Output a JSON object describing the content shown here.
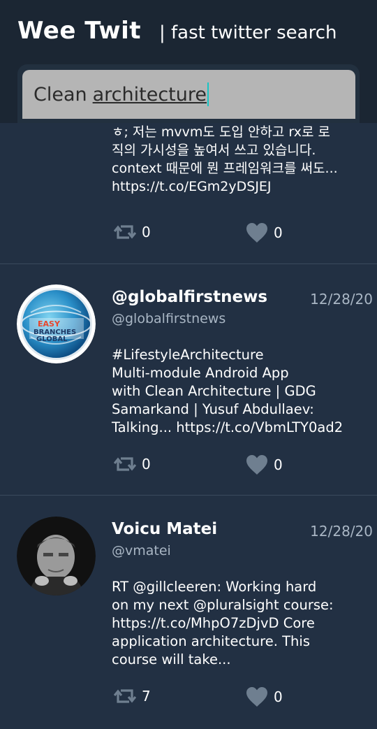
{
  "header": {
    "title": "Wee Twit",
    "subtitle": "| fast twitter search"
  },
  "search": {
    "value_prefix": "Clean",
    "value_underlined": "architecture"
  },
  "tweets": [
    {
      "text": "ㅎ; 저는 mvvm도 도입 안하고 rx로 로\n직의 가시성을 높여서 쓰고 있습니다.\ncontext 때문에 뭔 프레임워크를 써도...\nhttps://t.co/EGm2yDSJEJ",
      "retweets": "0",
      "likes": "0"
    },
    {
      "name": "@globalfirstnews",
      "handle": "@globalfirstnews",
      "date": "12/28/20",
      "text": "#LifestyleArchitecture\nMulti-module Android App\nwith Clean Architecture | GDG\nSamarkand | Yusuf Abdullaev:\nTalking... https://t.co/VbmLTY0ad2",
      "retweets": "0",
      "likes": "0",
      "avatar_logo": "EASY BRANCHES GLOBAL"
    },
    {
      "name": "Voicu Matei",
      "handle": "@vmatei",
      "date": "12/28/20",
      "text": "RT @gillcleeren: Working hard\non my next @pluralsight course:\nhttps://t.co/MhpO7zDjvD Core\napplication architecture. This\ncourse will take...",
      "retweets": "7",
      "likes": "0"
    }
  ],
  "icons": {
    "retweet": "retweet-icon",
    "like": "heart-icon"
  },
  "colors": {
    "background": "#223043",
    "header": "#1b2633",
    "search_field": "#b5b5b5",
    "caret": "#17c4c4",
    "muted_text": "#a9b6c4",
    "icon": "#6f7f90"
  }
}
